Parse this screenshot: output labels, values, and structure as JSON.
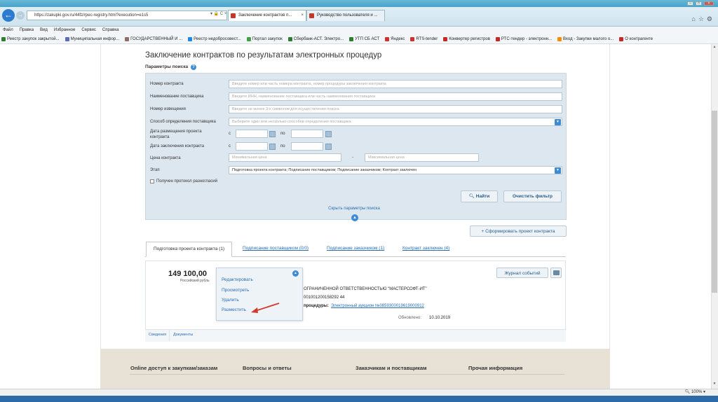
{
  "browser": {
    "url": "https://zakupki.gov.ru/44fz/rpec-registry.html?execution=e1s5",
    "tabs": [
      {
        "label": "Заключение контрактов п..."
      },
      {
        "label": "Руководство пользователя и ..."
      }
    ],
    "menu": [
      "Файл",
      "Правка",
      "Вид",
      "Избранное",
      "Сервис",
      "Справка"
    ],
    "favorites": [
      {
        "label": "Реестр закупок закрытой...",
        "color": "#2e7d32"
      },
      {
        "label": "Муниципальная инфор...",
        "color": "#5c6bc0"
      },
      {
        "label": "ГОСУДАРСТВЕННЫЙ И ...",
        "color": "#8d6e63"
      },
      {
        "label": "Реестр недобросовест...",
        "color": "#1e88e5"
      },
      {
        "label": "Портал закупок",
        "color": "#43a047"
      },
      {
        "label": "Сбербанк-АСТ. Электро...",
        "color": "#2e7d32"
      },
      {
        "label": "УТП СБ АСТ",
        "color": "#2e7d32"
      },
      {
        "label": "Яндекс",
        "color": "#d32f2f"
      },
      {
        "label": "RTS-tender",
        "color": "#d32f2f"
      },
      {
        "label": "Конвертер регистров",
        "color": "#c62828"
      },
      {
        "label": "РТС-тендер - электронн...",
        "color": "#c62828"
      },
      {
        "label": "Вход - Закупки малого о...",
        "color": "#fb8c00"
      },
      {
        "label": "О контрагенте",
        "color": "#c62828"
      }
    ],
    "zoom": "100%"
  },
  "page": {
    "title": "Заключение контрактов по результатам электронных процедур",
    "search_params_label": "Параметры поиска"
  },
  "filters": {
    "contract_number": {
      "label": "Номер контракта",
      "placeholder": "Введите номер или часть номера контракта, номер процедуры заключения контракта"
    },
    "supplier_name": {
      "label": "Наименование поставщика",
      "placeholder": "Введите ИНН, наименование поставщика или часть наименования поставщика"
    },
    "notice_number": {
      "label": "Номер извещения",
      "placeholder": "Введите не менее 3-х символов для осуществления поиска"
    },
    "supplier_method": {
      "label": "Способ определения поставщика",
      "placeholder": "Выберите один или несколько способов определения поставщика"
    },
    "draft_date": {
      "label": "Дата размещения проекта контракта",
      "from": "с",
      "to": "по"
    },
    "conclusion_date": {
      "label": "Дата заключения контракта",
      "from": "с",
      "to": "по"
    },
    "price": {
      "label": "Цена контракта",
      "min_placeholder": "Минимальная цена",
      "max_placeholder": "Максимальная цена",
      "dash": "-"
    },
    "stage": {
      "label": "Этап",
      "value": "Подготовка проекта контракта; Подписание поставщиком; Подписание заказчиком; Контракт заключен"
    },
    "disagreement_protocol": {
      "label": "Получен протокол разногласий"
    },
    "find_button": "Найти",
    "clear_button": "Очистить фильтр",
    "hide_params": "Скрыть параметры поиска"
  },
  "actions": {
    "form_contract": "Сформировать проект контракта"
  },
  "result_tabs": [
    {
      "label": "Подготовка проекта контракта (1)"
    },
    {
      "label": "Подписание поставщиком (0/0)"
    },
    {
      "label": "Подписание заказчиком (1)"
    },
    {
      "label": "Контракт заключен (4)"
    }
  ],
  "card": {
    "price": "149 100,00",
    "currency": "Российский рубль",
    "menu": [
      "Редактировать",
      "Просмотреть",
      "Удалить",
      "Разместить"
    ],
    "org_name": "ОГРАНИЧЕННОЙ ОТВЕТСТВЕННОСТЬЮ \"МАСТЕРСОФТ-ИТ\"",
    "reg_number": "001001200158292 44",
    "procedure_label": "процедуры:",
    "procedure_link": "Электронный аукцион №0859300019619000912",
    "updated_label": "Обновлено:",
    "updated_value": "10.10.2019",
    "event_log": "Журнал событий",
    "tabs": [
      "Сведения",
      "Документы"
    ]
  },
  "footer": {
    "columns": [
      "Online доступ к закупкам/заказам",
      "Вопросы и ответы",
      "Заказчикам и поставщикам",
      "Прочая информация"
    ]
  },
  "colors": {
    "accent": "#3d8bd4",
    "link": "#2a6db5",
    "panel": "#dde7ef",
    "arrow": "#d23a2c"
  }
}
